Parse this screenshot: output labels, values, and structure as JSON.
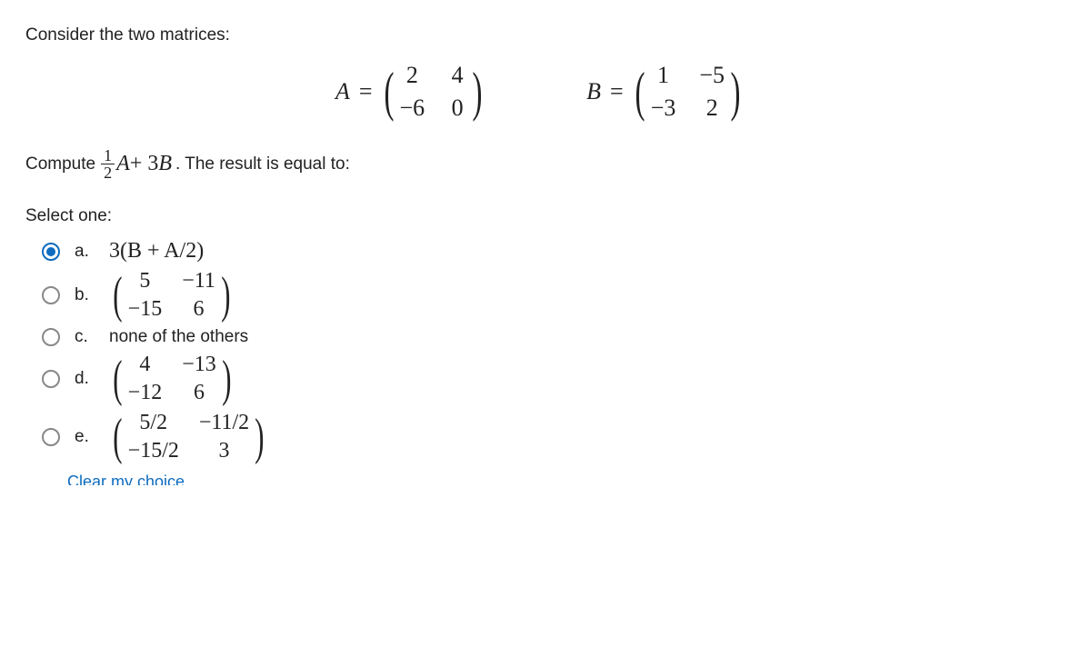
{
  "prompt": "Consider the two matrices:",
  "matrices": {
    "A": {
      "label": "A",
      "eq": "=",
      "cells": [
        "2",
        "4",
        "−6",
        "0"
      ]
    },
    "B": {
      "label": "B",
      "eq": "=",
      "cells": [
        "1",
        "−5",
        "−3",
        "2"
      ]
    }
  },
  "compute": {
    "prefix": "Compute ",
    "frac_num": "1",
    "frac_den": "2",
    "mid1": "A",
    "plus": " + 3",
    "mid2": "B",
    "suffix": ". The result is equal to:"
  },
  "select_label": "Select one:",
  "answers": [
    {
      "letter": "a.",
      "type": "text",
      "text": "3(B + A/2)",
      "selected": true
    },
    {
      "letter": "b.",
      "type": "matrix",
      "cells": [
        "5",
        "−11",
        "−15",
        "6"
      ],
      "selected": false
    },
    {
      "letter": "c.",
      "type": "plain",
      "text": "none of the others",
      "selected": false
    },
    {
      "letter": "d.",
      "type": "matrix",
      "cells": [
        "4",
        "−13",
        "−12",
        "6"
      ],
      "selected": false
    },
    {
      "letter": "e.",
      "type": "matrix",
      "cells": [
        "5/2",
        "−11/2",
        "−15/2",
        "3"
      ],
      "selected": false
    }
  ],
  "clear_label": "Clear my choice"
}
